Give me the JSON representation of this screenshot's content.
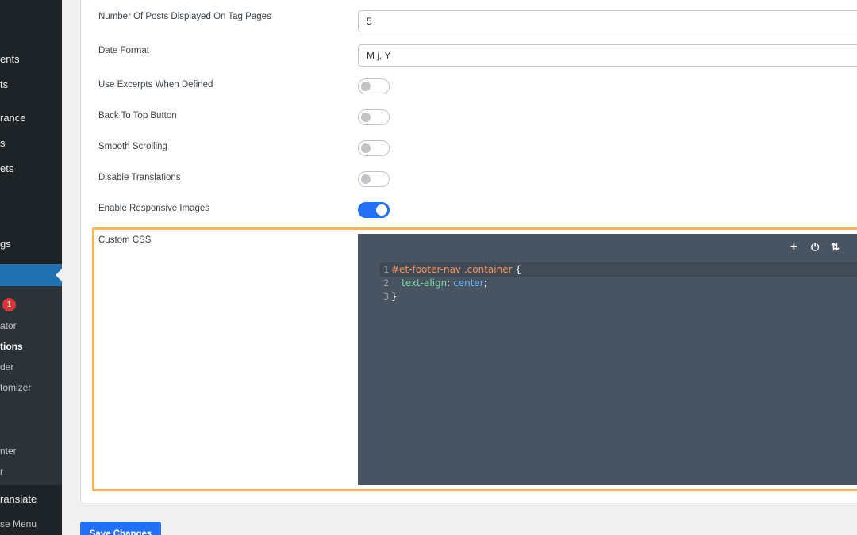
{
  "sidebar": {
    "items": [
      {
        "label": "ents"
      },
      {
        "label": "ts"
      },
      {
        "label": "rance"
      },
      {
        "label": "s"
      },
      {
        "label": "ets"
      },
      {
        "label": "gs"
      },
      {
        "label": ""
      },
      {
        "label": "ator"
      },
      {
        "label": "tions"
      },
      {
        "label": "der"
      },
      {
        "label": "tomizer"
      },
      {
        "label": "nter"
      },
      {
        "label": "r"
      },
      {
        "label": "ranslate"
      },
      {
        "label": "se Menu"
      }
    ],
    "badge": "1"
  },
  "settings": {
    "posts_on_tag_pages": {
      "label": "Number Of Posts Displayed On Tag Pages",
      "value": "5"
    },
    "date_format": {
      "label": "Date Format",
      "value": "M j, Y"
    },
    "use_excerpts": {
      "label": "Use Excerpts When Defined",
      "enabled": false
    },
    "back_to_top": {
      "label": "Back To Top Button",
      "enabled": false
    },
    "smooth_scrolling": {
      "label": "Smooth Scrolling",
      "enabled": false
    },
    "disable_translations": {
      "label": "Disable Translations",
      "enabled": false
    },
    "responsive_images": {
      "label": "Enable Responsive Images",
      "enabled": true
    },
    "custom_css": {
      "label": "Custom CSS",
      "lines": [
        {
          "number": "1",
          "selector": "#et-footer-nav .container",
          "open": " {"
        },
        {
          "number": "2",
          "property": "text-align",
          "colon": ": ",
          "value": "center",
          "end": ";"
        },
        {
          "number": "3",
          "close": "}"
        }
      ]
    }
  },
  "editor_toolbar": {
    "add_icon": "plus-icon",
    "power_icon": "power-icon",
    "sort_icon": "sort-arrows-icon"
  },
  "actions": {
    "save_label": "Save Changes"
  },
  "colors": {
    "accent": "#2271f4",
    "highlight": "#f6b45c",
    "editor_bg": "#495462",
    "sidebar_bg": "#1d2327"
  }
}
